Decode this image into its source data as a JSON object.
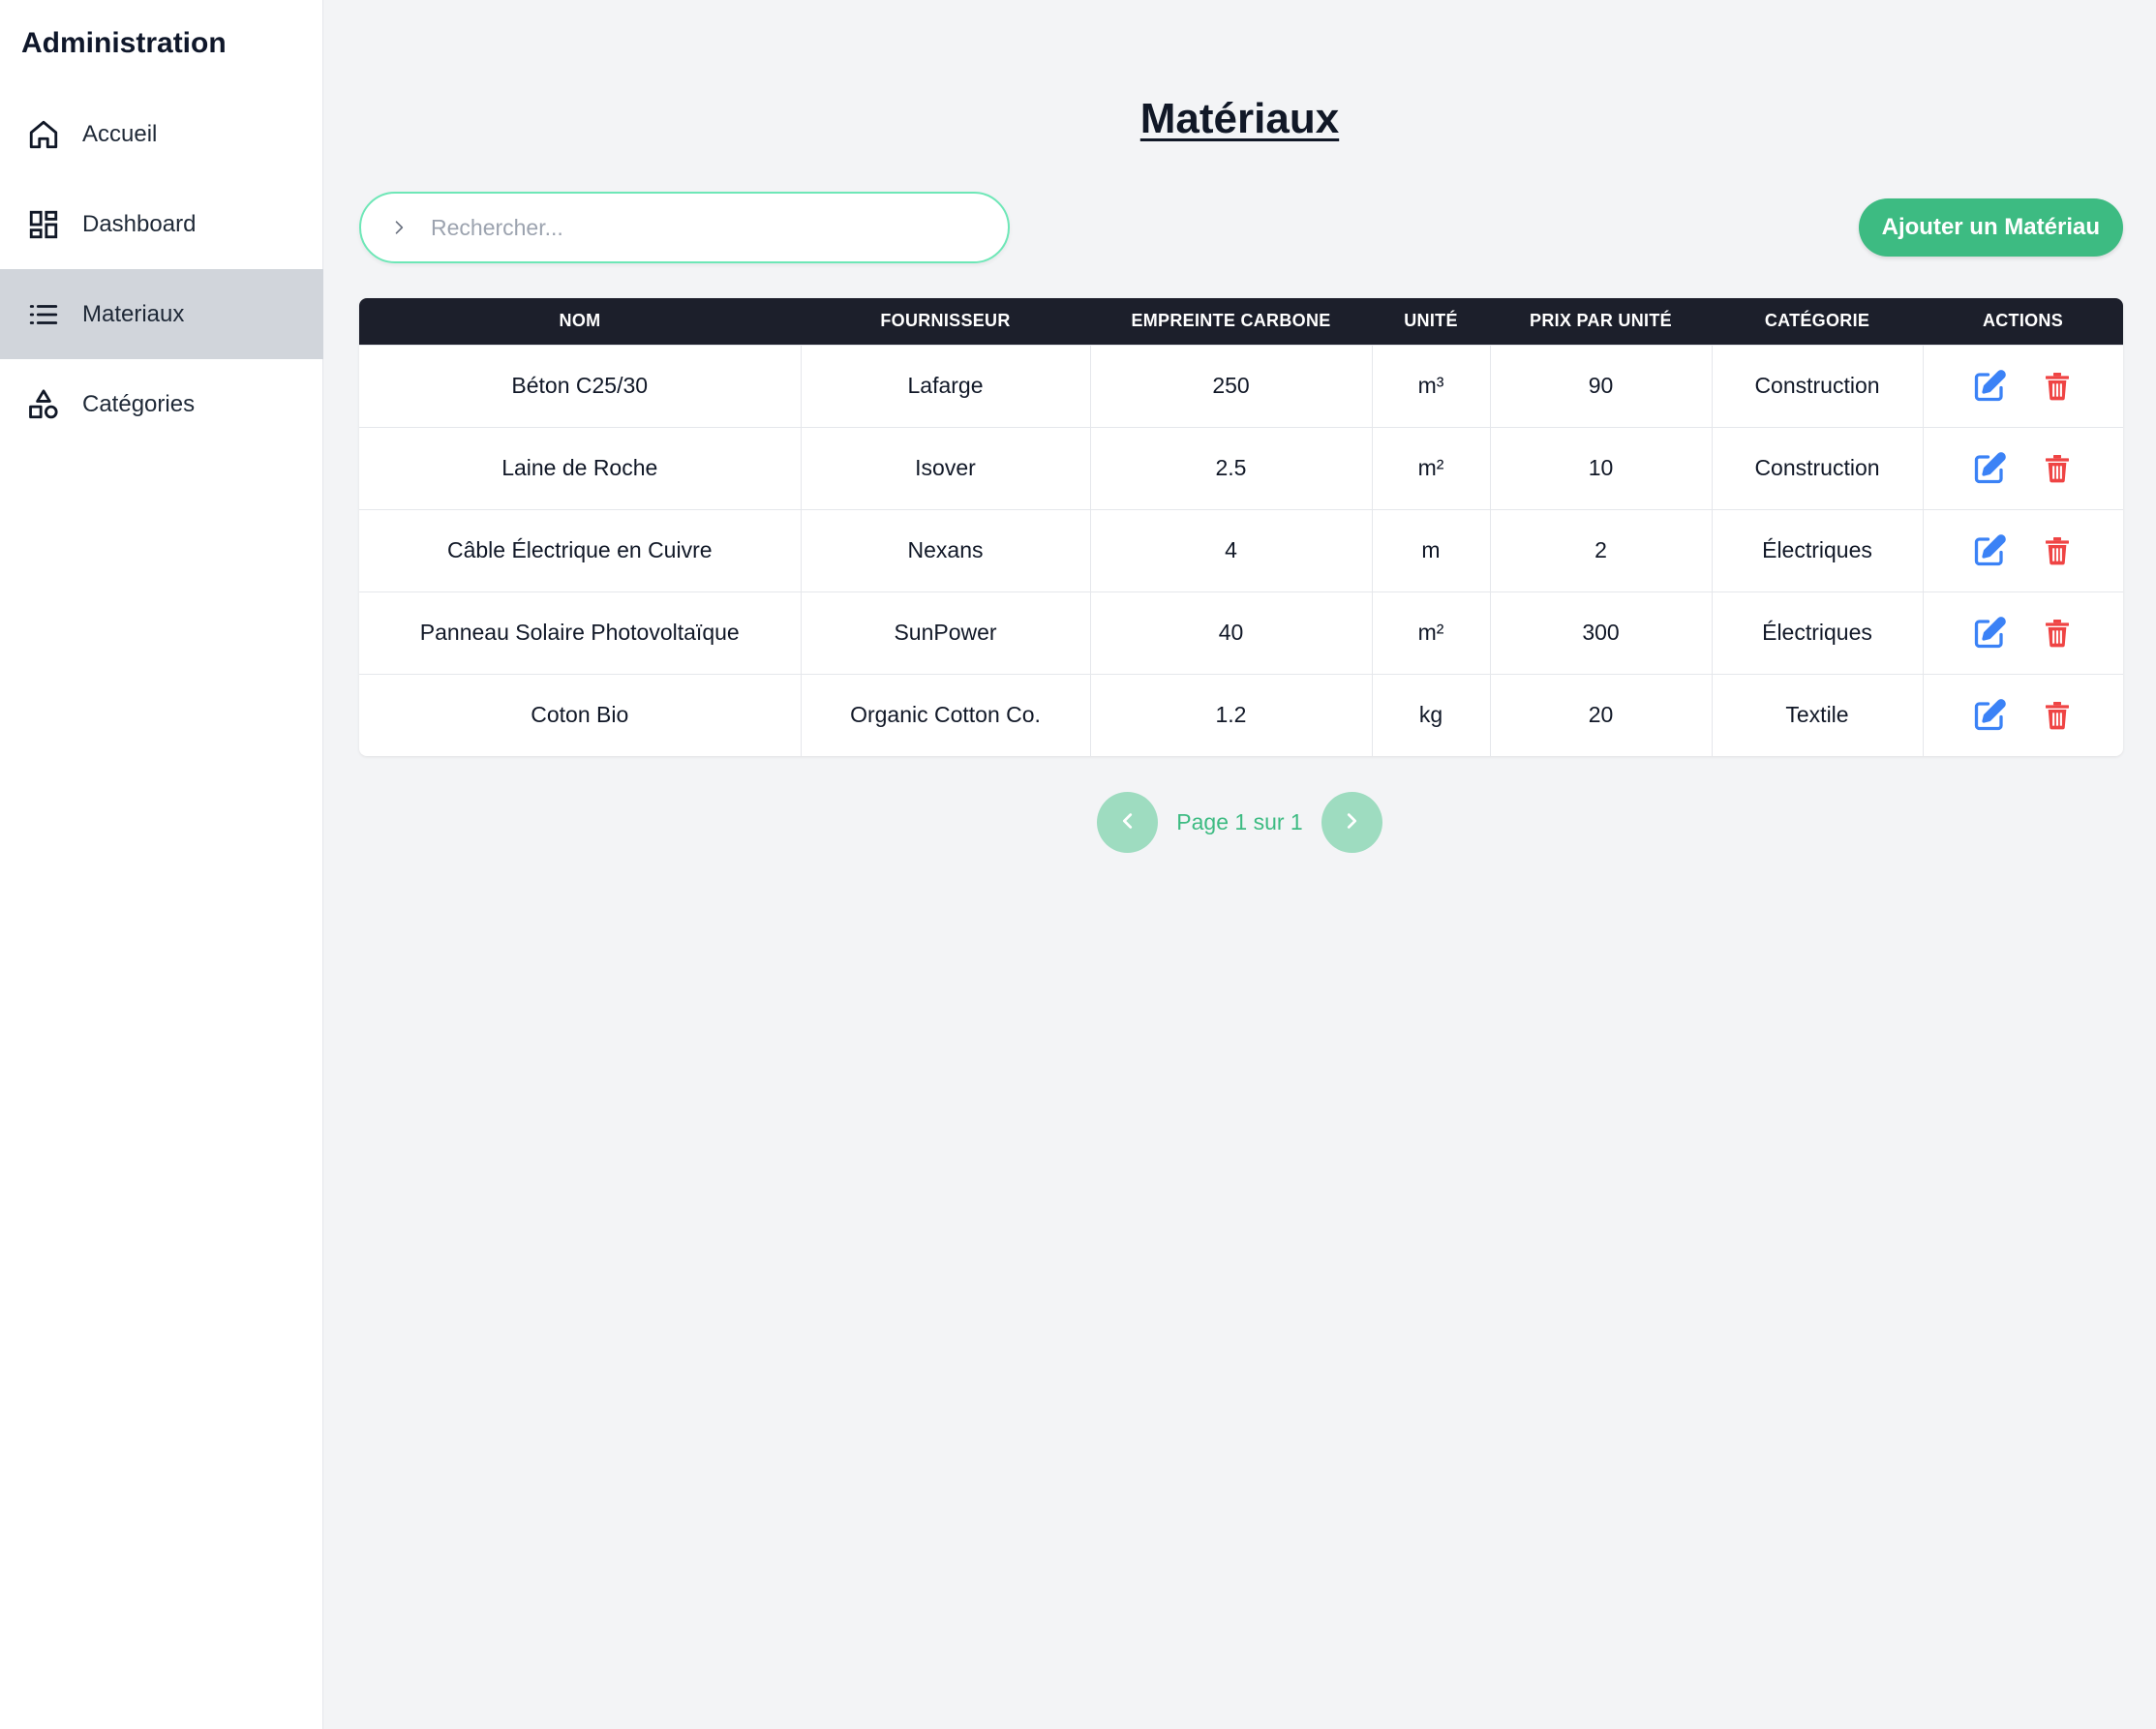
{
  "sidebar": {
    "title": "Administration",
    "items": [
      {
        "label": "Accueil",
        "icon": "home-icon"
      },
      {
        "label": "Dashboard",
        "icon": "dashboard-icon"
      },
      {
        "label": "Materiaux",
        "icon": "list-icon",
        "active": true
      },
      {
        "label": "Catégories",
        "icon": "shapes-icon"
      }
    ]
  },
  "page": {
    "title": "Matériaux"
  },
  "search": {
    "placeholder": "Rechercher...",
    "value": ""
  },
  "toolbar": {
    "add_label": "Ajouter un Matériau"
  },
  "table": {
    "columns": [
      "Nom",
      "Fournisseur",
      "Empreinte carbone",
      "Unité",
      "Prix par unité",
      "Catégorie",
      "Actions"
    ],
    "rows": [
      {
        "nom": "Béton C25/30",
        "fournisseur": "Lafarge",
        "empreinte": "250",
        "unite": "m³",
        "prix": "90",
        "categorie": "Construction"
      },
      {
        "nom": "Laine de Roche",
        "fournisseur": "Isover",
        "empreinte": "2.5",
        "unite": "m²",
        "prix": "10",
        "categorie": "Construction"
      },
      {
        "nom": "Câble Électrique en Cuivre",
        "fournisseur": "Nexans",
        "empreinte": "4",
        "unite": "m",
        "prix": "2",
        "categorie": "Électriques"
      },
      {
        "nom": "Panneau Solaire Photovoltaïque",
        "fournisseur": "SunPower",
        "empreinte": "40",
        "unite": "m²",
        "prix": "300",
        "categorie": "Électriques"
      },
      {
        "nom": "Coton Bio",
        "fournisseur": "Organic Cotton Co.",
        "empreinte": "1.2",
        "unite": "kg",
        "prix": "20",
        "categorie": "Textile"
      }
    ]
  },
  "pagination": {
    "text": "Page 1 sur 1"
  },
  "colors": {
    "accent": "#3dbb82",
    "header_bg": "#1c1f2b",
    "edit": "#3b82f6",
    "delete": "#ef4444"
  }
}
